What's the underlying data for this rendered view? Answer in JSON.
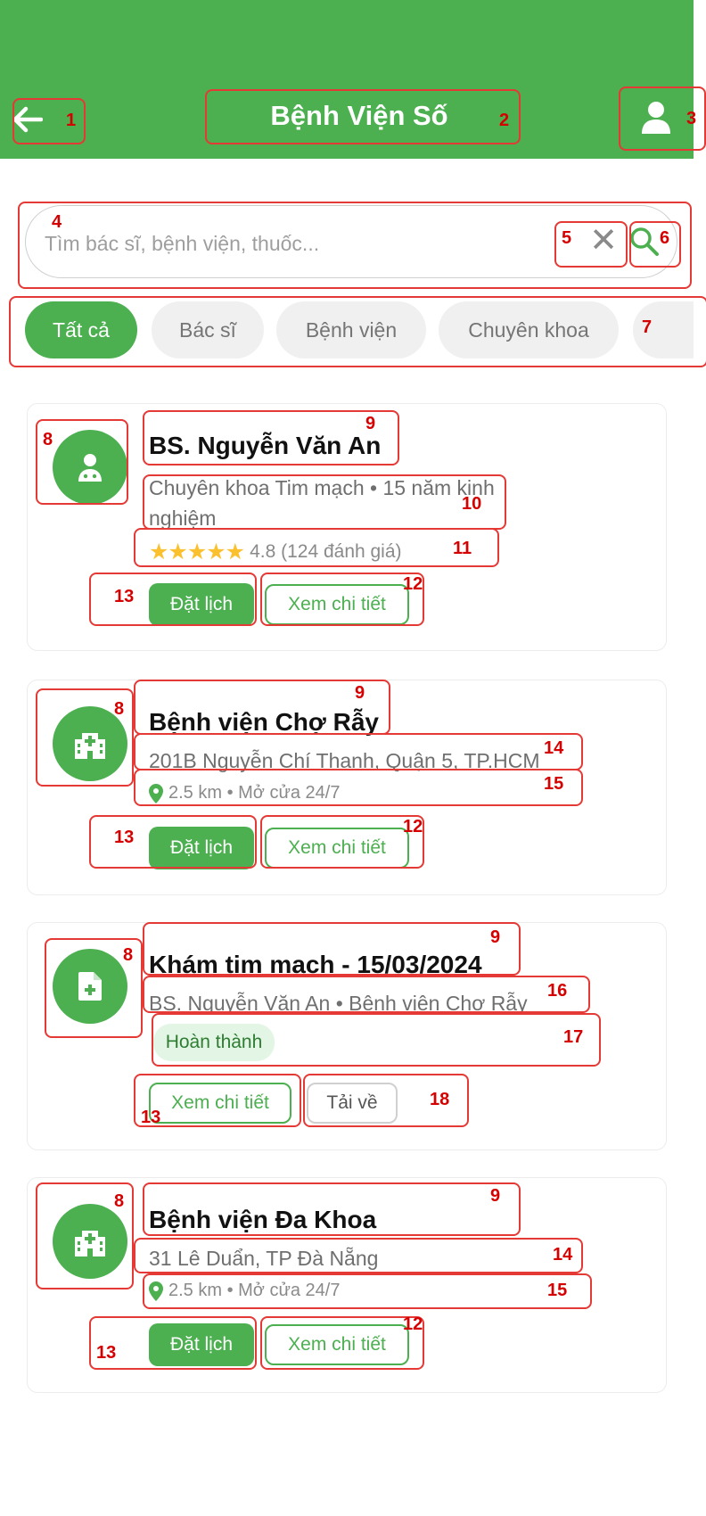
{
  "header": {
    "title": "Bệnh Viện Số",
    "background": "#4caf50",
    "back_icon": "arrow-left-icon",
    "profile_icon": "user-icon"
  },
  "search": {
    "placeholder": "Tìm bác sĩ, bệnh viện, thuốc...",
    "value": "",
    "clear_label": "✕"
  },
  "filters": [
    "Tất cả",
    "Bác sĩ",
    "Bệnh viện",
    "Chuyên khoa"
  ],
  "active_filter": "Tất cả",
  "cards": [
    {
      "icon": "doctor-icon",
      "title": "BS. Nguyễn Văn An",
      "subtitle": "Chuyên khoa Tim mạch • 15 năm kinh nghiệm",
      "rating_value": 4.8,
      "rating_text": "4.8 (124 đánh giá)",
      "primary_action": "Đặt lịch",
      "secondary_action": "Xem chi tiết"
    },
    {
      "icon": "hospital-icon",
      "title": "Bệnh viện Chợ Rẫy",
      "address": "201B Nguyễn Chí Thanh, Quận 5, TP.HCM",
      "meta": "2.5 km • Mở cửa 24/7",
      "primary_action": "Đặt lịch",
      "secondary_action": "Xem chi tiết"
    },
    {
      "icon": "medical-record-icon",
      "title": "Khám tim mạch - 15/03/2024",
      "subtitle": "BS. Nguyễn Văn An • Bệnh viện Chợ Rẫy",
      "status": "Hoàn thành",
      "primary_action": "Xem chi tiết",
      "secondary_action": "Tải về"
    },
    {
      "icon": "hospital-icon",
      "title": "Bệnh viện Đa Khoa",
      "address": "31 Lê Duẩn, TP Đà Nẵng",
      "meta": "2.5 km • Mở cửa 24/7",
      "primary_action": "Đặt lịch",
      "secondary_action": "Xem chi tiết"
    }
  ],
  "annotation_labels": [
    "1",
    "2",
    "3",
    "4",
    "5",
    "6",
    "7",
    "8",
    "9",
    "10",
    "11",
    "12",
    "13",
    "14",
    "15",
    "16",
    "17",
    "18"
  ]
}
